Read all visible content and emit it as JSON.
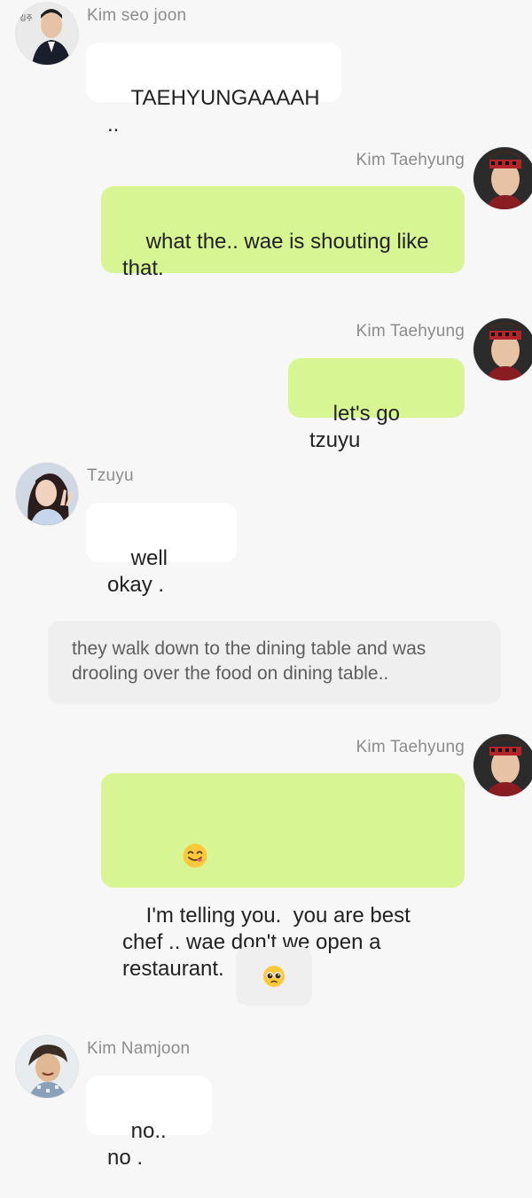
{
  "messages": [
    {
      "side": "left",
      "name": "Kim seo joon",
      "text": "TAEHYUNGAAAAH ..",
      "avatar": "kim-seo-joon-avatar"
    },
    {
      "side": "right",
      "name": "Kim Taehyung",
      "text": "what the.. wae is shouting like that.",
      "avatar": "kim-taehyung-avatar"
    },
    {
      "side": "right",
      "name": "Kim Taehyung",
      "text": "let's go tzuyu",
      "avatar": "kim-taehyung-avatar"
    },
    {
      "side": "left",
      "name": "Tzuyu",
      "text": "well okay .",
      "avatar": "tzuyu-avatar"
    },
    {
      "type": "narration",
      "text": "they walk down to the dining table and was drooling over the food on dining table.."
    },
    {
      "side": "right",
      "name": "Kim Taehyung",
      "emoji": "yum-face",
      "text": "I'm telling you.  you are best chef .. wae don't we open a restaurant.",
      "avatar": "kim-taehyung-avatar"
    },
    {
      "type": "emoji",
      "emoji": "pleading-face"
    },
    {
      "side": "left",
      "name": "Kim Namjoon",
      "text": "no.. no .",
      "avatar": "kim-namjoon-avatar"
    }
  ],
  "colors": {
    "background": "#f7f7f7",
    "right_bubble": "#d7f593",
    "left_bubble": "#ffffff",
    "narration": "#efefef",
    "name_text": "#8c8c8c"
  }
}
